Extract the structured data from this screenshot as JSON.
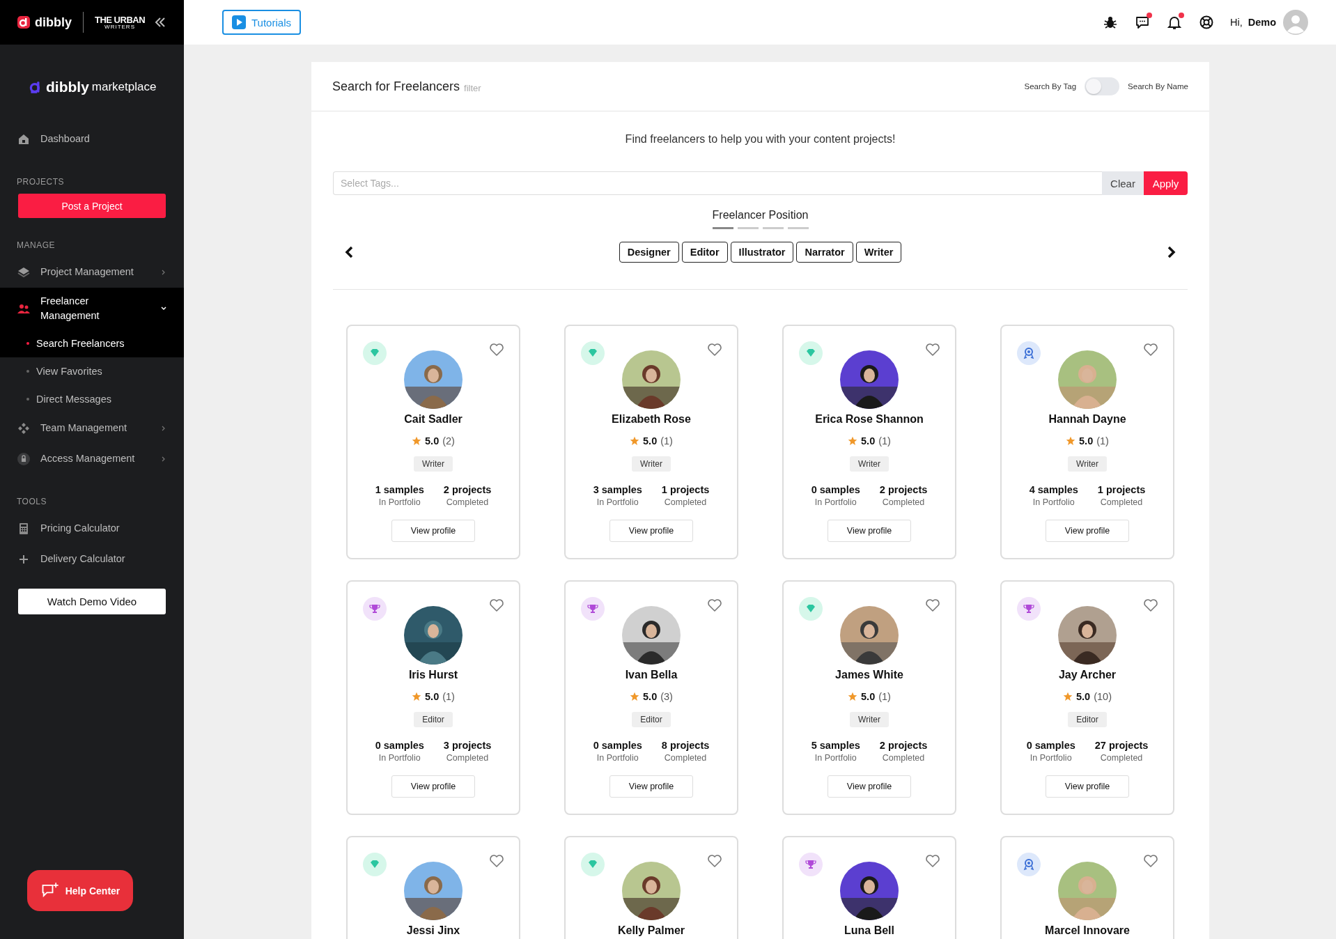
{
  "sidebar": {
    "brand": {
      "logo": "dibbly",
      "partner_line1": "THE URBAN",
      "partner_line2": "WRITERS",
      "app_logo": "dibbly",
      "app_suffix": "marketplace"
    },
    "sections": [
      {
        "items": [
          {
            "kind": "home",
            "label": "Dashboard",
            "selected": false
          }
        ]
      },
      {
        "heading": "PROJECTS",
        "button": "Post a Project"
      },
      {
        "heading": "MANAGE",
        "items": [
          {
            "kind": "layers",
            "label": "Project Management",
            "selected": false,
            "expanded": false
          },
          {
            "kind": "people",
            "label": "Freelancer Management",
            "selected": true,
            "expanded": true,
            "children": [
              {
                "label": "Search Freelancers",
                "selected": true
              },
              {
                "label": "View Favorites",
                "selected": false
              },
              {
                "label": "Direct Messages",
                "selected": false
              }
            ]
          },
          {
            "kind": "diamonds",
            "label": "Team Management",
            "selected": false,
            "expanded": false
          },
          {
            "kind": "lock",
            "label": "Access Management",
            "selected": false,
            "expanded": false
          }
        ]
      },
      {
        "heading": "TOOLS",
        "items": [
          {
            "kind": "calculator",
            "label": "Pricing Calculator",
            "selected": false
          },
          {
            "kind": "plus",
            "label": "Delivery Calculator",
            "selected": false
          }
        ]
      }
    ],
    "demo_button": "Watch Demo Video",
    "help_button": "Help Center"
  },
  "header": {
    "tutorials": "Tutorials",
    "icons": [
      {
        "kind": "bug",
        "unread": false
      },
      {
        "kind": "chat",
        "unread": true
      },
      {
        "kind": "bell",
        "unread": true
      },
      {
        "kind": "lifebuoy",
        "unread": false
      }
    ],
    "greeting": "Hi,",
    "user": "Demo"
  },
  "panel": {
    "title": "Search for Freelancers",
    "subtitle": "filter",
    "toggle": {
      "left_label": "Search By Tag",
      "right_label": "Search By Name",
      "on": false
    },
    "tagline": "Find freelancers to help you with your content projects!",
    "tags_field": {
      "placeholder": "Select Tags..."
    },
    "clear_button": "Clear",
    "apply_button": "Apply",
    "position": {
      "title": "Freelancer Position",
      "pages": [
        {
          "selected": true
        },
        {
          "selected": false
        },
        {
          "selected": false
        },
        {
          "selected": false
        }
      ],
      "chips": [
        "Designer",
        "Editor",
        "Illustrator",
        "Narrator",
        "Writer"
      ]
    },
    "freelancers": [
      {
        "kind": "diamond",
        "name": "Cait Sadler",
        "rating": "5.0",
        "reviews": "(2)",
        "role": "Writer",
        "samples": "1 samples",
        "samples_label": "In Portfolio",
        "projects": "2 projects",
        "projects_label": "Completed",
        "button": "View profile"
      },
      {
        "kind": "diamond",
        "name": "Elizabeth Rose",
        "rating": "5.0",
        "reviews": "(1)",
        "role": "Writer",
        "samples": "3 samples",
        "samples_label": "In Portfolio",
        "projects": "1 projects",
        "projects_label": "Completed",
        "button": "View profile"
      },
      {
        "kind": "diamond",
        "name": "Erica Rose Shannon",
        "rating": "5.0",
        "reviews": "(1)",
        "role": "Writer",
        "samples": "0 samples",
        "samples_label": "In Portfolio",
        "projects": "2 projects",
        "projects_label": "Completed",
        "button": "View profile"
      },
      {
        "kind": "award",
        "name": "Hannah Dayne",
        "rating": "5.0",
        "reviews": "(1)",
        "role": "Writer",
        "samples": "4 samples",
        "samples_label": "In Portfolio",
        "projects": "1 projects",
        "projects_label": "Completed",
        "button": "View profile"
      },
      {
        "kind": "trophy",
        "name": "Iris Hurst",
        "rating": "5.0",
        "reviews": "(1)",
        "role": "Editor",
        "samples": "0 samples",
        "samples_label": "In Portfolio",
        "projects": "3 projects",
        "projects_label": "Completed",
        "button": "View profile"
      },
      {
        "kind": "trophy",
        "name": "Ivan Bella",
        "rating": "5.0",
        "reviews": "(3)",
        "role": "Editor",
        "samples": "0 samples",
        "samples_label": "In Portfolio",
        "projects": "8 projects",
        "projects_label": "Completed",
        "button": "View profile"
      },
      {
        "kind": "diamond",
        "name": "James White",
        "rating": "5.0",
        "reviews": "(1)",
        "role": "Writer",
        "samples": "5 samples",
        "samples_label": "In Portfolio",
        "projects": "2 projects",
        "projects_label": "Completed",
        "button": "View profile"
      },
      {
        "kind": "trophy",
        "name": "Jay Archer",
        "rating": "5.0",
        "reviews": "(10)",
        "role": "Editor",
        "samples": "0 samples",
        "samples_label": "In Portfolio",
        "projects": "27 projects",
        "projects_label": "Completed",
        "button": "View profile"
      },
      {
        "kind": "diamond",
        "name": "Jessi Jinx"
      },
      {
        "kind": "diamond",
        "name": "Kelly Palmer"
      },
      {
        "kind": "trophy",
        "name": "Luna Bell"
      },
      {
        "kind": "award",
        "name": "Marcel Innovare"
      }
    ]
  }
}
